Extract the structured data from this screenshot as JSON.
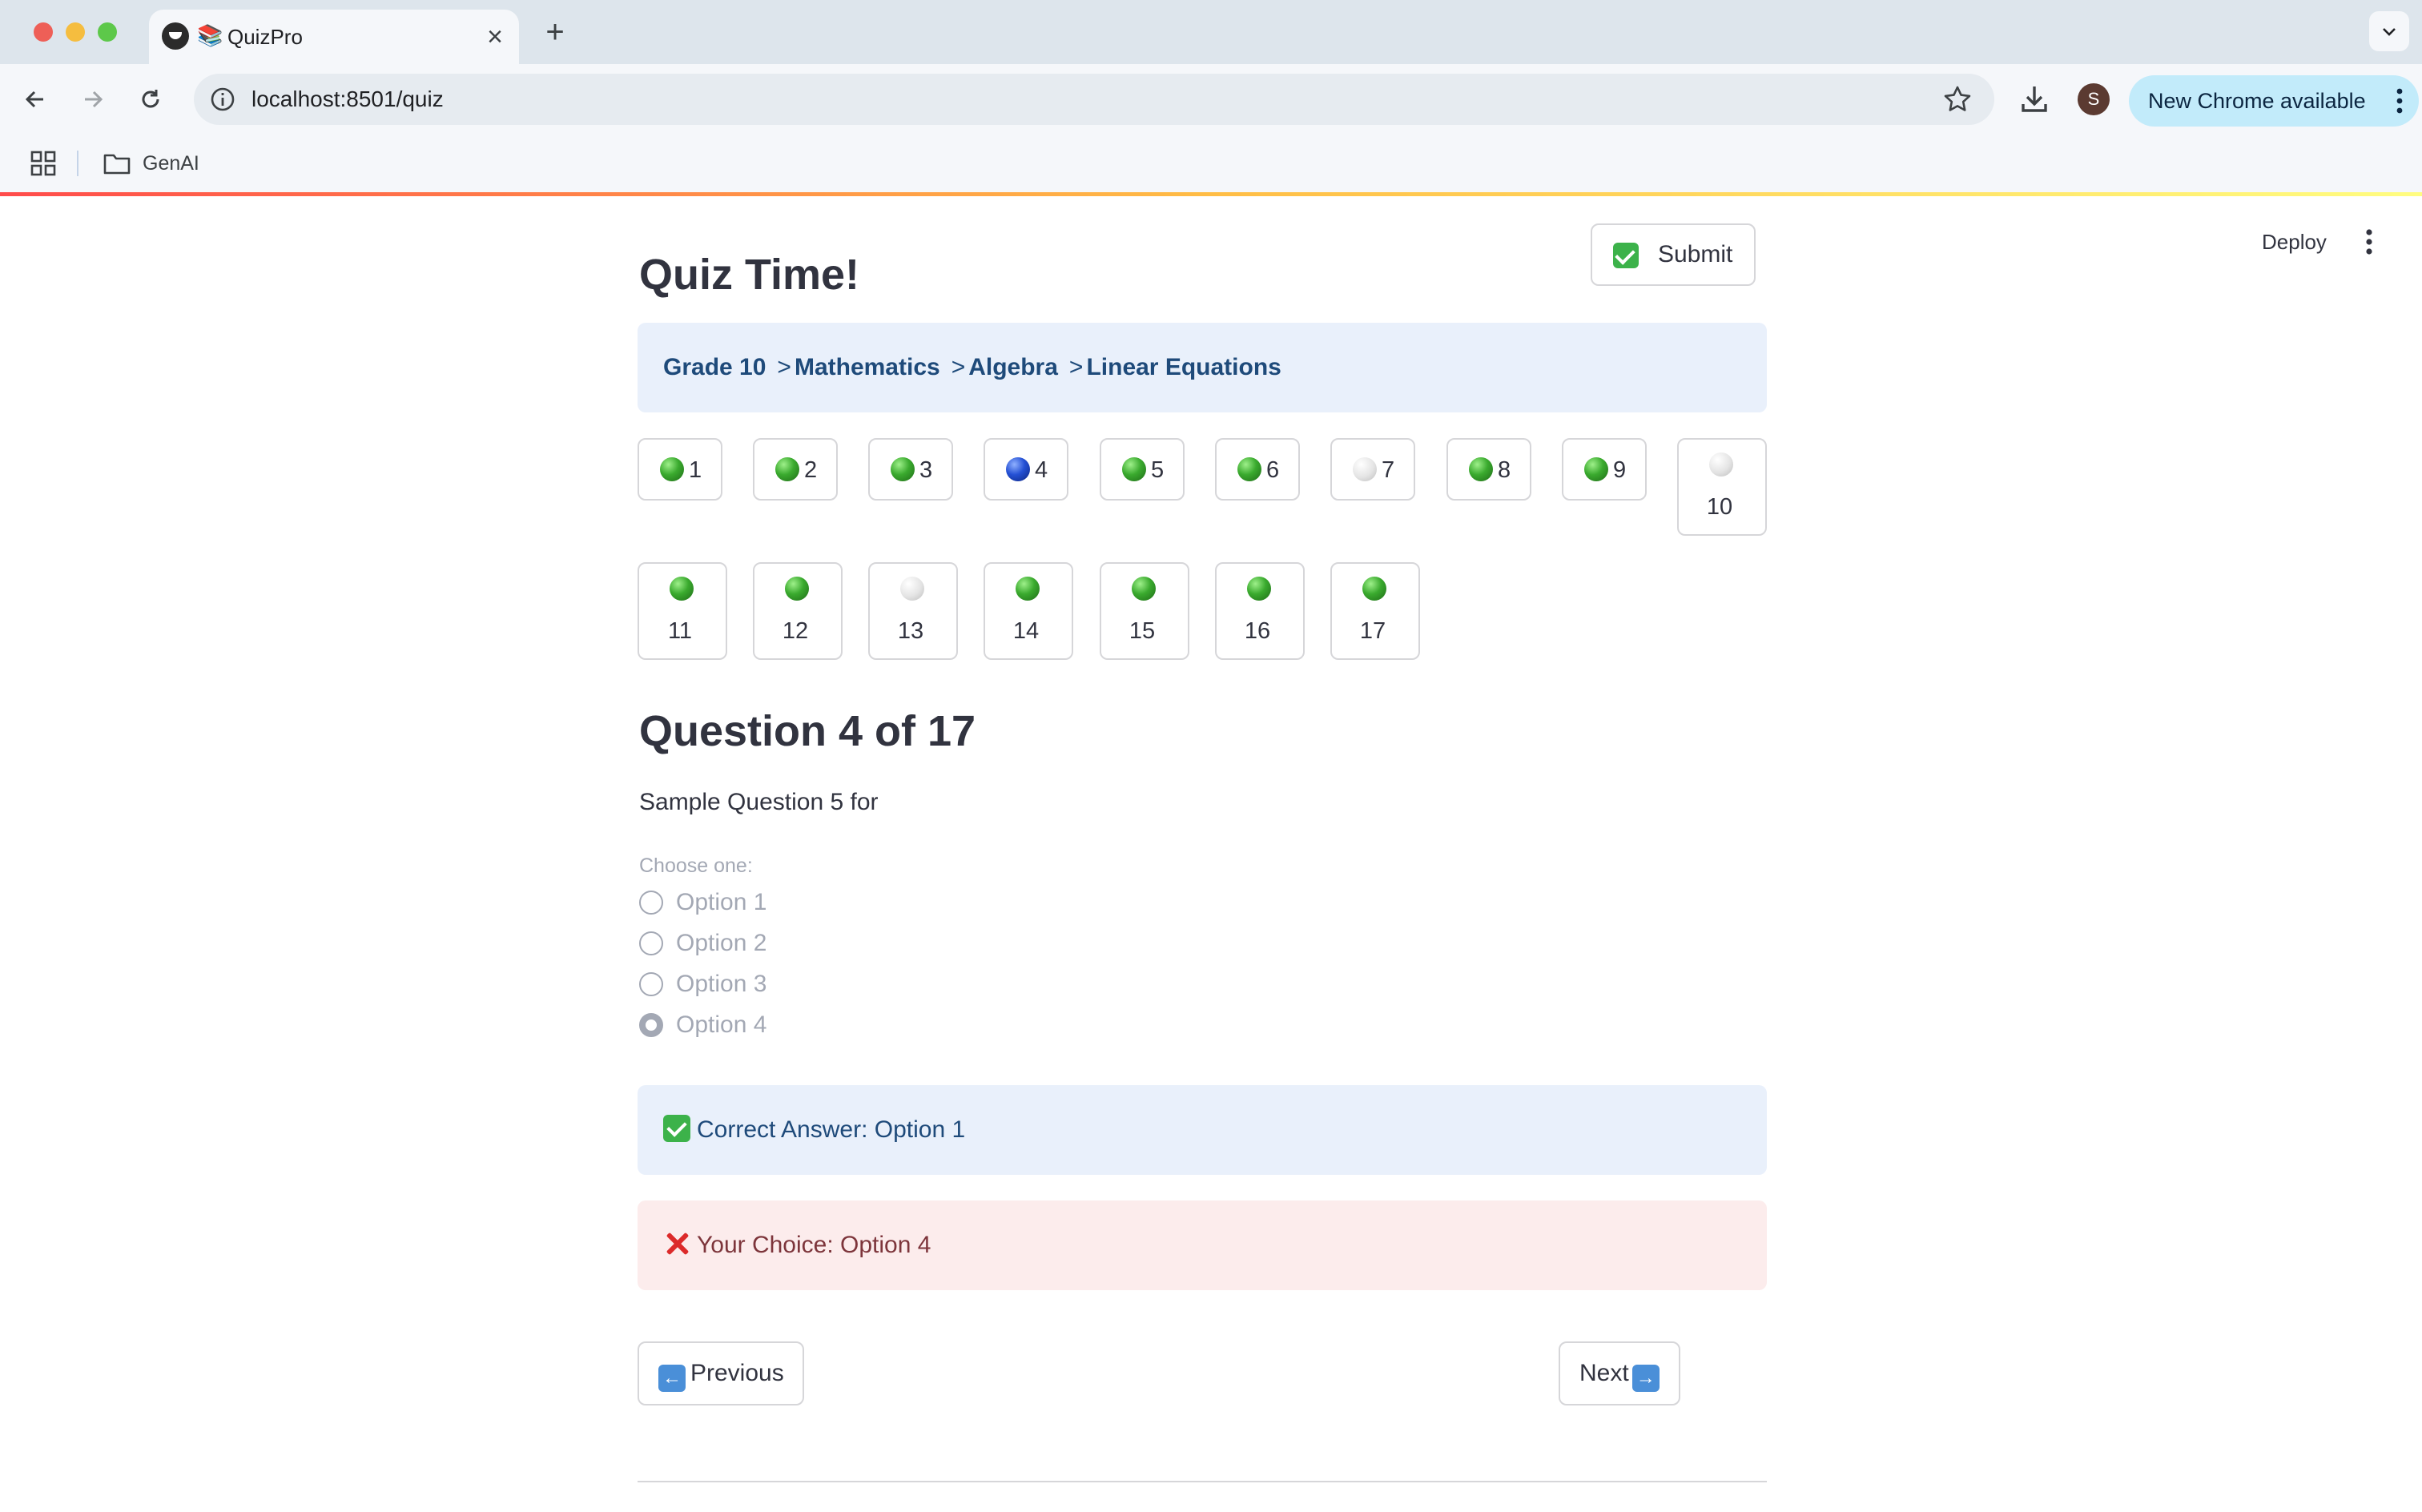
{
  "browser": {
    "tab_title": "QuizPro",
    "tab_emoji": "📚",
    "url": "localhost:8501/quiz",
    "new_chrome_label": "New Chrome available",
    "profile_initial": "S",
    "bookmark_folder": "GenAI"
  },
  "header": {
    "deploy_label": "Deploy"
  },
  "quiz": {
    "title": "Quiz Time!",
    "submit_label": "Submit",
    "breadcrumb": {
      "grade": "Grade 10",
      "subject": "Mathematics",
      "topic": "Algebra",
      "subtopic": "Linear Equations",
      "separator": ">"
    },
    "question_buttons": [
      {
        "number": "1",
        "status": "answered",
        "color": "#3aaa2e"
      },
      {
        "number": "2",
        "status": "answered",
        "color": "#3aaa2e"
      },
      {
        "number": "3",
        "status": "answered",
        "color": "#3aaa2e"
      },
      {
        "number": "4",
        "status": "current",
        "color": "#2450d4"
      },
      {
        "number": "5",
        "status": "answered",
        "color": "#3aaa2e"
      },
      {
        "number": "6",
        "status": "answered",
        "color": "#3aaa2e"
      },
      {
        "number": "7",
        "status": "unanswered",
        "color": "#e4e4e4"
      },
      {
        "number": "8",
        "status": "answered",
        "color": "#3aaa2e"
      },
      {
        "number": "9",
        "status": "answered",
        "color": "#3aaa2e"
      },
      {
        "number": "10",
        "status": "unanswered",
        "color": "#e4e4e4"
      },
      {
        "number": "11",
        "status": "answered",
        "color": "#3aaa2e"
      },
      {
        "number": "12",
        "status": "answered",
        "color": "#3aaa2e"
      },
      {
        "number": "13",
        "status": "unanswered",
        "color": "#e4e4e4"
      },
      {
        "number": "14",
        "status": "answered",
        "color": "#3aaa2e"
      },
      {
        "number": "15",
        "status": "answered",
        "color": "#3aaa2e"
      },
      {
        "number": "16",
        "status": "answered",
        "color": "#3aaa2e"
      },
      {
        "number": "17",
        "status": "answered",
        "color": "#3aaa2e"
      }
    ],
    "question_heading": "Question 4 of 17",
    "question_text": "Sample Question 5 for",
    "choose_label": "Choose one:",
    "options": [
      "Option 1",
      "Option 2",
      "Option 3",
      "Option 4"
    ],
    "selected_option": "Option 4",
    "correct_answer": "Correct Answer: Option 1",
    "your_choice": "Your Choice: Option 4",
    "previous_label": "Previous",
    "next_label": "Next"
  }
}
